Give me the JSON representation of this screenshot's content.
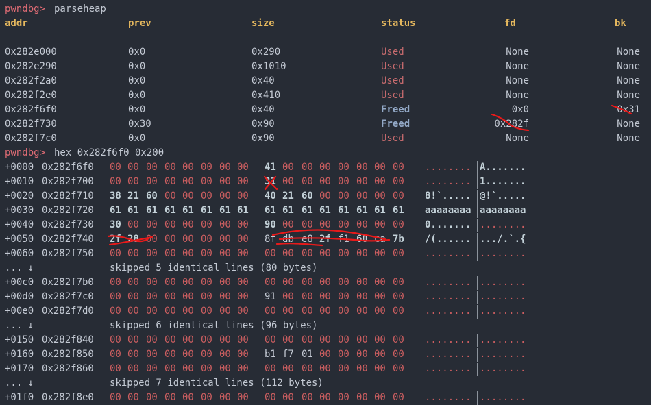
{
  "prompt": "pwndbg>",
  "commands": {
    "parseheap": "parseheap",
    "hex": "hex 0x282f6f0 0x200"
  },
  "heap_headers": [
    "addr",
    "prev",
    "size",
    "status",
    "fd",
    "bk"
  ],
  "heap_rows": [
    {
      "addr": "0x282e000",
      "prev": "0x0",
      "size": "0x290",
      "status": "Used",
      "fd": "None",
      "bk": "None"
    },
    {
      "addr": "0x282e290",
      "prev": "0x0",
      "size": "0x1010",
      "status": "Used",
      "fd": "None",
      "bk": "None"
    },
    {
      "addr": "0x282f2a0",
      "prev": "0x0",
      "size": "0x40",
      "status": "Used",
      "fd": "None",
      "bk": "None"
    },
    {
      "addr": "0x282f2e0",
      "prev": "0x0",
      "size": "0x410",
      "status": "Used",
      "fd": "None",
      "bk": "None"
    },
    {
      "addr": "0x282f6f0",
      "prev": "0x0",
      "size": "0x40",
      "status": "Freed",
      "fd": "0x0",
      "bk": "0x31"
    },
    {
      "addr": "0x282f730",
      "prev": "0x30",
      "size": "0x90",
      "status": "Freed",
      "fd": "0x282f",
      "bk": "None"
    },
    {
      "addr": "0x282f7c0",
      "prev": "0x0",
      "size": "0x90",
      "status": "Used",
      "fd": "None",
      "bk": "None"
    }
  ],
  "hex_lines": [
    {
      "type": "hex",
      "off": "+0000",
      "addr": "0x282f6f0",
      "bytes": [
        "00",
        "00",
        "00",
        "00",
        "00",
        "00",
        "00",
        "00",
        "41",
        "00",
        "00",
        "00",
        "00",
        "00",
        "00",
        "00"
      ],
      "ascii1": "........",
      "ascii2": "A......."
    },
    {
      "type": "hex",
      "off": "+0010",
      "addr": "0x282f700",
      "bytes": [
        "00",
        "00",
        "00",
        "00",
        "00",
        "00",
        "00",
        "00",
        "31",
        "00",
        "00",
        "00",
        "00",
        "00",
        "00",
        "00"
      ],
      "ascii1": "........",
      "ascii2": "1......."
    },
    {
      "type": "hex",
      "off": "+0020",
      "addr": "0x282f710",
      "bytes": [
        "38",
        "21",
        "60",
        "00",
        "00",
        "00",
        "00",
        "00",
        "40",
        "21",
        "60",
        "00",
        "00",
        "00",
        "00",
        "00"
      ],
      "ascii1": "8!`.....",
      "ascii2": "@!`....."
    },
    {
      "type": "hex",
      "off": "+0030",
      "addr": "0x282f720",
      "bytes": [
        "61",
        "61",
        "61",
        "61",
        "61",
        "61",
        "61",
        "61",
        "61",
        "61",
        "61",
        "61",
        "61",
        "61",
        "61",
        "61"
      ],
      "ascii1": "aaaaaaaa",
      "ascii2": "aaaaaaaa"
    },
    {
      "type": "hex",
      "off": "+0040",
      "addr": "0x282f730",
      "bytes": [
        "30",
        "00",
        "00",
        "00",
        "00",
        "00",
        "00",
        "00",
        "90",
        "00",
        "00",
        "00",
        "00",
        "00",
        "00",
        "00"
      ],
      "ascii1": "0.......",
      "ascii2": "........"
    },
    {
      "type": "hex",
      "off": "+0050",
      "addr": "0x282f740",
      "bytes": [
        "2f",
        "28",
        "00",
        "00",
        "00",
        "00",
        "00",
        "00",
        "8f",
        "db",
        "e8",
        "2f",
        "f1",
        "60",
        "ca",
        "7b"
      ],
      "ascii1": "/(......",
      "ascii2": ".../.`.{"
    },
    {
      "type": "hex",
      "off": "+0060",
      "addr": "0x282f750",
      "bytes": [
        "00",
        "00",
        "00",
        "00",
        "00",
        "00",
        "00",
        "00",
        "00",
        "00",
        "00",
        "00",
        "00",
        "00",
        "00",
        "00"
      ],
      "ascii1": "........",
      "ascii2": "........"
    },
    {
      "type": "skip",
      "lead": "... ↓",
      "text": "skipped 5 identical lines (80 bytes)"
    },
    {
      "type": "hex",
      "off": "+00c0",
      "addr": "0x282f7b0",
      "bytes": [
        "00",
        "00",
        "00",
        "00",
        "00",
        "00",
        "00",
        "00",
        "00",
        "00",
        "00",
        "00",
        "00",
        "00",
        "00",
        "00"
      ],
      "ascii1": "........",
      "ascii2": "........"
    },
    {
      "type": "hex",
      "off": "+00d0",
      "addr": "0x282f7c0",
      "bytes": [
        "00",
        "00",
        "00",
        "00",
        "00",
        "00",
        "00",
        "00",
        "91",
        "00",
        "00",
        "00",
        "00",
        "00",
        "00",
        "00"
      ],
      "ascii1": "........",
      "ascii2": "........"
    },
    {
      "type": "hex",
      "off": "+00e0",
      "addr": "0x282f7d0",
      "bytes": [
        "00",
        "00",
        "00",
        "00",
        "00",
        "00",
        "00",
        "00",
        "00",
        "00",
        "00",
        "00",
        "00",
        "00",
        "00",
        "00"
      ],
      "ascii1": "........",
      "ascii2": "........"
    },
    {
      "type": "skip",
      "lead": "... ↓",
      "text": "skipped 6 identical lines (96 bytes)"
    },
    {
      "type": "hex",
      "off": "+0150",
      "addr": "0x282f840",
      "bytes": [
        "00",
        "00",
        "00",
        "00",
        "00",
        "00",
        "00",
        "00",
        "00",
        "00",
        "00",
        "00",
        "00",
        "00",
        "00",
        "00"
      ],
      "ascii1": "........",
      "ascii2": "........"
    },
    {
      "type": "hex",
      "off": "+0160",
      "addr": "0x282f850",
      "bytes": [
        "00",
        "00",
        "00",
        "00",
        "00",
        "00",
        "00",
        "00",
        "b1",
        "f7",
        "01",
        "00",
        "00",
        "00",
        "00",
        "00"
      ],
      "ascii1": "........",
      "ascii2": "........"
    },
    {
      "type": "hex",
      "off": "+0170",
      "addr": "0x282f860",
      "bytes": [
        "00",
        "00",
        "00",
        "00",
        "00",
        "00",
        "00",
        "00",
        "00",
        "00",
        "00",
        "00",
        "00",
        "00",
        "00",
        "00"
      ],
      "ascii1": "........",
      "ascii2": "........"
    },
    {
      "type": "skip",
      "lead": "... ↓",
      "text": "skipped 7 identical lines (112 bytes)"
    },
    {
      "type": "hex",
      "off": "+01f0",
      "addr": "0x282f8e0",
      "bytes": [
        "00",
        "00",
        "00",
        "00",
        "00",
        "00",
        "00",
        "00",
        "00",
        "00",
        "00",
        "00",
        "00",
        "00",
        "00",
        "00"
      ],
      "ascii1": "........",
      "ascii2": "........"
    }
  ],
  "colors": {
    "background": "#272c35",
    "prompt": "#e06c75",
    "header": "#e5b85e",
    "used": "#c76b6e",
    "freed": "#93a9c7",
    "zero_byte": "#cc5e60",
    "annotation": "#e81a1a"
  }
}
